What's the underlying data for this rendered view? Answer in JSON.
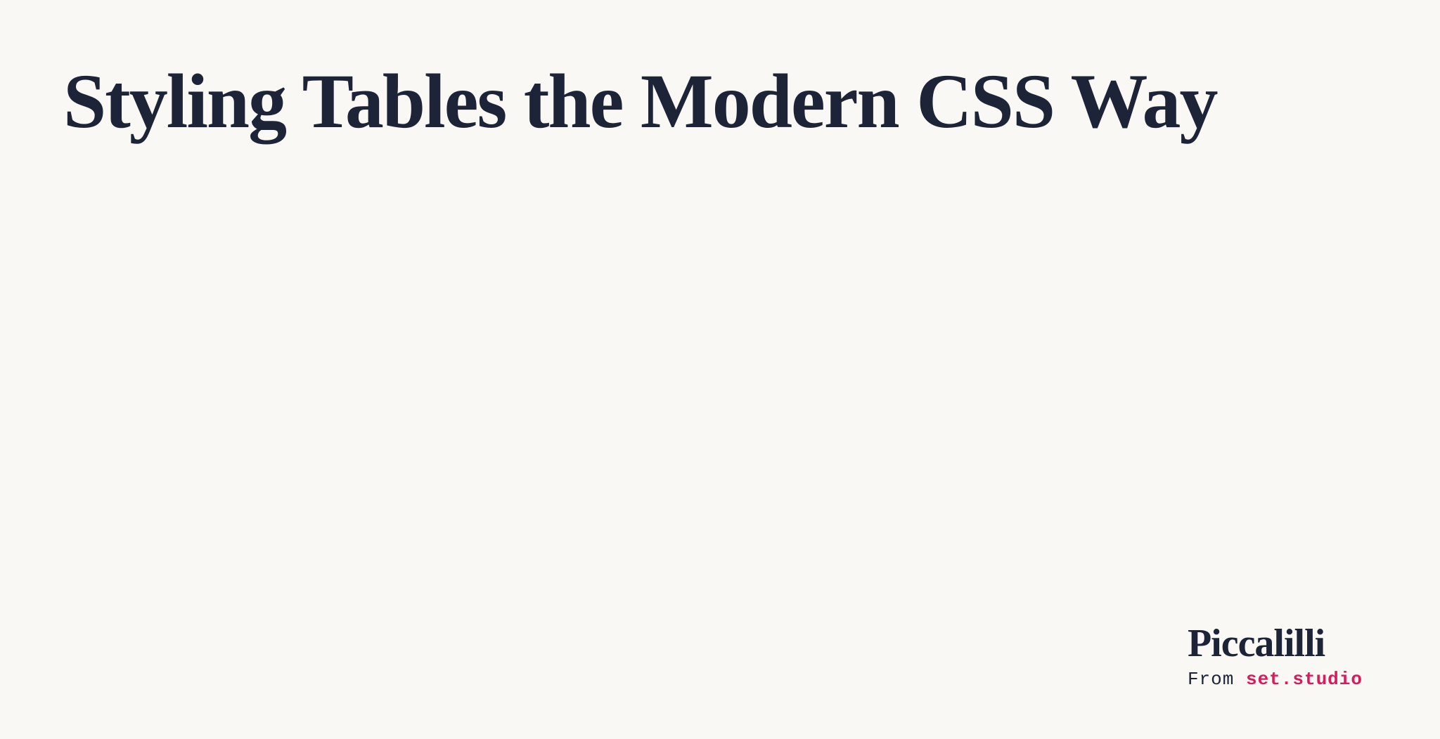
{
  "article": {
    "title": "Styling Tables the Modern CSS Way"
  },
  "brand": {
    "name": "Piccalilli",
    "tagline_prefix": "From ",
    "tagline_link": "set.studio"
  }
}
